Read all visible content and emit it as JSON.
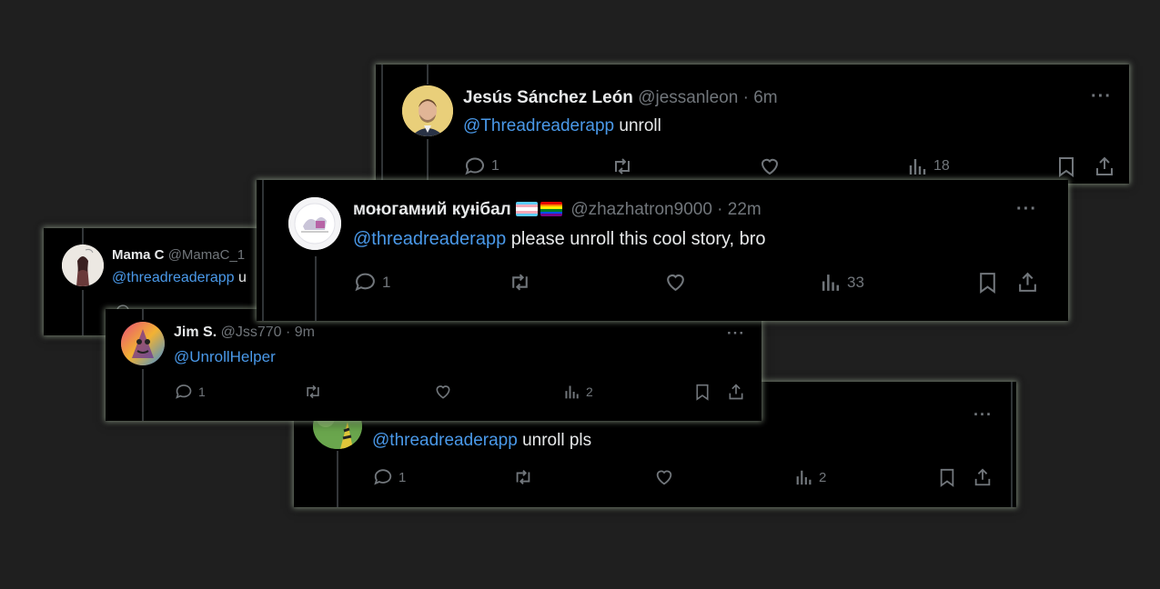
{
  "colors": {
    "background": "#1f1f1f",
    "card": "#000000",
    "mention": "#4a99e9",
    "muted": "#71767b",
    "text": "#e7e9ea"
  },
  "tweets": [
    {
      "name": "Jesús Sánchez León",
      "handle": "@jessanleon",
      "time": "6m",
      "mention": "@Threadreaderapp",
      "text": " unroll",
      "replies": "1",
      "views": "18"
    },
    {
      "name": "моᵻогамᵻий куᵻібал",
      "handle": "@zhazhatron9000",
      "time": "22m",
      "mention": "@threadreaderapp",
      "text": " please unroll this cool story, bro",
      "replies": "1",
      "views": "33",
      "flags": [
        "transgender-flag",
        "rainbow-flag"
      ]
    },
    {
      "name": "Mama C",
      "handle": "@MamaC_1",
      "mention": "@threadreaderapp",
      "text": " u"
    },
    {
      "name": "Jim S.",
      "handle": "@Jss770",
      "time": "9m",
      "mention": "@UnrollHelper",
      "text": "",
      "replies": "1",
      "views": "2"
    },
    {
      "mention": "@threadreaderapp",
      "text": " unroll pls",
      "replies": "1",
      "views": "2"
    }
  ],
  "more_label": "···",
  "separator": "·",
  "icons": [
    "reply-icon",
    "retweet-icon",
    "like-icon",
    "views-icon",
    "bookmark-icon",
    "share-icon",
    "more-icon"
  ]
}
